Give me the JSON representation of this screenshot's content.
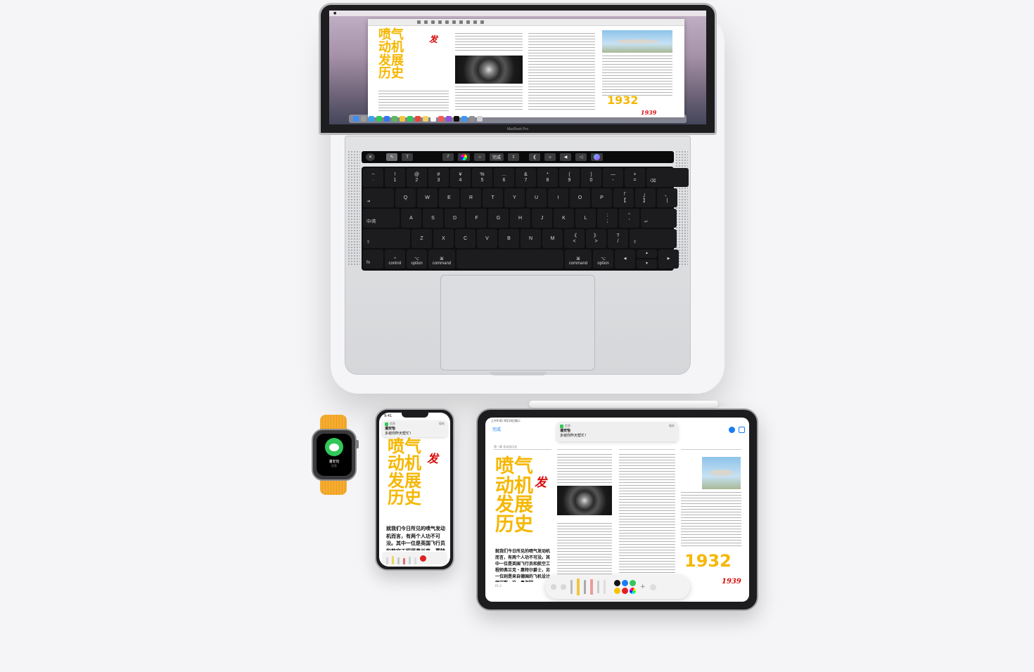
{
  "macbook": {
    "menu_items": [
      "",
      "",
      "",
      "",
      "",
      "",
      ""
    ],
    "doc_title_lines": [
      "喷气",
      "动机",
      "发展",
      "历史"
    ],
    "annotation_char": "发",
    "year": "1932",
    "year_correction": "1939",
    "label": "MacBook Pro",
    "touchbar": {
      "done": "完成"
    },
    "keyboard": {
      "row1": [
        [
          "~",
          "·"
        ],
        [
          "!",
          "1"
        ],
        [
          "@",
          "2"
        ],
        [
          "#",
          "3"
        ],
        [
          "¥",
          "4"
        ],
        [
          "%",
          "5"
        ],
        [
          "…",
          "6"
        ],
        [
          "&",
          "7"
        ],
        [
          "*",
          "8"
        ],
        [
          "(",
          "9"
        ],
        [
          ")",
          "0"
        ],
        [
          "—",
          "-"
        ],
        [
          "+",
          "="
        ]
      ],
      "row2": [
        "Q",
        "W",
        "E",
        "R",
        "T",
        "Y",
        "U",
        "I",
        "O",
        "P"
      ],
      "row2_brackets": [
        [
          "「",
          "【"
        ],
        [
          "」",
          "】"
        ],
        [
          "、",
          "|"
        ]
      ],
      "row3": [
        "A",
        "S",
        "D",
        "F",
        "G",
        "H",
        "J",
        "K",
        "L"
      ],
      "row3_punct": [
        [
          ":",
          ";"
        ],
        [
          "“",
          "'"
        ]
      ],
      "row4": [
        "Z",
        "X",
        "C",
        "V",
        "B",
        "N",
        "M"
      ],
      "row4_punct": [
        [
          "《",
          "<"
        ],
        [
          "》",
          ">"
        ],
        [
          "?",
          "/"
        ]
      ],
      "tab_key": "⇥",
      "caps_key": "中/英",
      "shift_key": "⇧",
      "return_key": "↩",
      "delete_key": "⌫",
      "fn": "fn",
      "control": "control",
      "option": "option",
      "command": "command",
      "control_sym": "^",
      "option_sym": "⌥",
      "command_sym": "⌘",
      "arrow_left": "◀",
      "arrow_right": "▶",
      "arrow_up": "▲",
      "arrow_down": "▼"
    }
  },
  "watch": {
    "contact": "潘安怡",
    "subtitle": "信息"
  },
  "iphone": {
    "time": "9:41",
    "notif_app": "信息",
    "notif_time": "现在",
    "notif_title": "潘安怡",
    "notif_body": "多谢你昨天帮忙！",
    "title_lines": [
      "喷气",
      "动机",
      "发展",
      "历史"
    ],
    "annotation_char": "发",
    "body": "就我们今日所见的喷气发动机而言，有两个人功不可没。其中一位是英国飞行员和航空工程师弗兰克・惠特尔爵士，另一位则是来自德国的飞机设计师汉斯・冯・奥"
  },
  "ipad": {
    "time": "上午9:41  9月10日周二",
    "done": "完成",
    "notif_app": "信息",
    "notif_time": "现在",
    "notif_title": "潘安怡",
    "notif_body": "多谢你昨天帮忙！",
    "section_label": "第一章 发动机历史",
    "title_lines": [
      "喷气",
      "动机",
      "发展",
      "历史"
    ],
    "annotation_char": "发",
    "body": "就我们今日所见的喷气发动机而言，有两个人功不可没。其中一位是英国飞行员和航空工程师弗兰克・惠特尔爵士，另一位则是来自德国的飞机设计师汉斯・冯・奥海因。",
    "year": "1932",
    "year_correction": "1939",
    "page_num": "P1.3"
  },
  "colors": {
    "title_yellow": "#f5b700",
    "annotation_red": "#d80a0a",
    "messages_green": "#31c85a",
    "link_blue": "#1a7cf4",
    "watch_band": "#f6a823"
  }
}
